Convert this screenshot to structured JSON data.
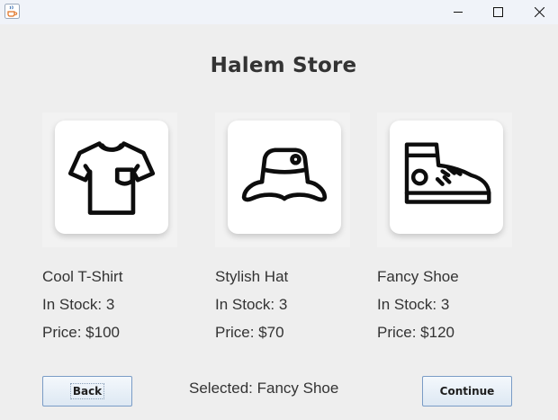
{
  "window": {
    "app_icon": "java-coffee-cup-icon",
    "controls": [
      "minimize-icon",
      "maximize-icon",
      "close-icon"
    ]
  },
  "store": {
    "title": "Halem Store"
  },
  "products": [
    {
      "name": "Cool T-Shirt",
      "stock": "In Stock: 3",
      "price": "Price: $100",
      "icon": "t-shirt-icon"
    },
    {
      "name": "Stylish Hat",
      "stock": "In Stock: 3",
      "price": "Price: $70",
      "icon": "bucket-hat-icon"
    },
    {
      "name": "Fancy Shoe",
      "stock": "In Stock: 3",
      "price": "Price: $120",
      "icon": "sneaker-icon"
    }
  ],
  "footer": {
    "back_label": "Back",
    "selected_text": "Selected: Fancy Shoe",
    "continue_label": "Continue"
  },
  "colors": {
    "background": "#eeeeee",
    "text": "#333333",
    "button_border": "#7a9cc6"
  }
}
